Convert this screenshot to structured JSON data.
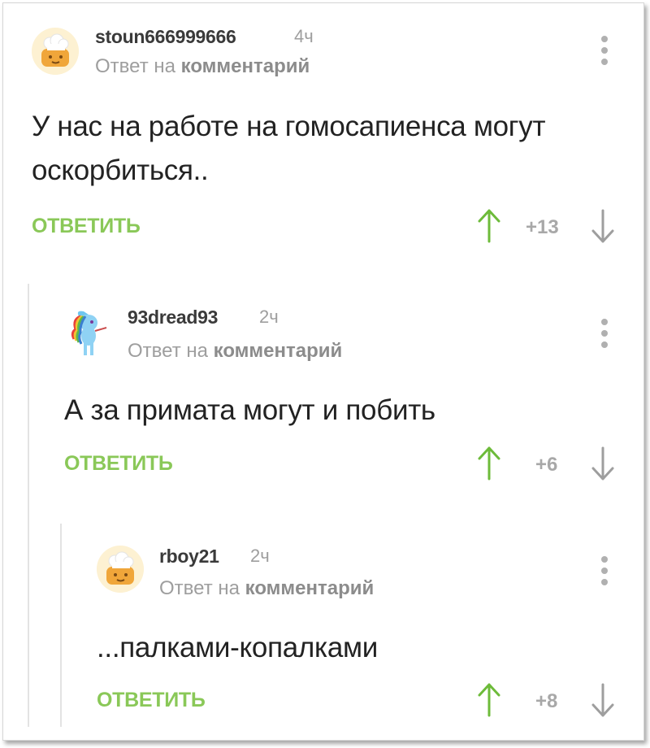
{
  "colors": {
    "accent_green": "#8ac858",
    "up_arrow": "#6dbb3a",
    "muted": "#9e9e9e",
    "thread_line": "#e3e3e3"
  },
  "comments": [
    {
      "username": "stoun666999666",
      "time": "4ч",
      "reply_prefix": "Ответ на",
      "reply_target": "комментарий",
      "text": "У нас на работе на гомосапиенса могут оскорбиться..",
      "reply_label": "ОТВЕТИТЬ",
      "score": "+13",
      "avatar_icon": "chef-hat-avatar-icon"
    },
    {
      "username": "93dread93",
      "time": "2ч",
      "reply_prefix": "Ответ на",
      "reply_target": "комментарий",
      "text": "А за примата могут и побить",
      "reply_label": "ОТВЕТИТЬ",
      "score": "+6",
      "avatar_icon": "rainbow-pony-avatar-icon"
    },
    {
      "username": "rboy21",
      "time": "2ч",
      "reply_prefix": "Ответ на",
      "reply_target": "комментарий",
      "text": "...палками-копалками",
      "reply_label": "ОТВЕТИТЬ",
      "score": "+8",
      "avatar_icon": "chef-hat-avatar-icon"
    }
  ]
}
